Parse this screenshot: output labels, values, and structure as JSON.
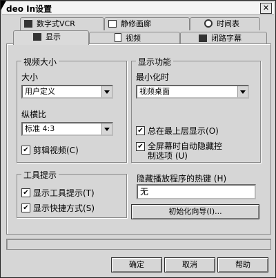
{
  "window": {
    "title": "deo In设置"
  },
  "tabs_back": [
    {
      "label": "数字式VCR",
      "icon": "vcr-icon"
    },
    {
      "label": "静修画廊",
      "icon": "gallery-icon"
    },
    {
      "label": "时间表",
      "icon": "clock-icon"
    }
  ],
  "tabs_front": [
    {
      "label": "显示",
      "icon": "display-icon",
      "active": true
    },
    {
      "label": "视频",
      "icon": "video-icon"
    },
    {
      "label": "闭路字幕",
      "icon": "caption-icon"
    }
  ],
  "video_size": {
    "legend": "视频大小",
    "size_label": "大小",
    "size_value": "用户定义",
    "aspect_label": "纵横比",
    "aspect_value": "标准 4:3",
    "crop_label": "剪辑视频",
    "crop_key": "(C)",
    "crop_checked": true
  },
  "display_features": {
    "legend": "显示功能",
    "minimize_label": "最小化时",
    "minimize_value": "视频桌面",
    "ontop_label": "总在最上层显示",
    "ontop_key": "(O)",
    "ontop_checked": true,
    "fullscreen_label_1": "全屏幕时自动隐藏控",
    "fullscreen_label_2": "制选项",
    "fullscreen_key": "(U)",
    "fullscreen_checked": true
  },
  "tooltips": {
    "legend": "工具提示",
    "show_tips_label": "显示工具提示",
    "show_tips_key": "(T)",
    "show_tips_checked": true,
    "show_shortcut_label": "显示快捷方式",
    "show_shortcut_key": "(S)",
    "show_shortcut_checked": true
  },
  "hotkey": {
    "label": "隐藏播放程序的热键",
    "key": "(H)",
    "value": "无"
  },
  "wizard_button": "初始化向导(I)...",
  "footer": {
    "ok": "确定",
    "cancel": "取消",
    "help": "帮助"
  }
}
